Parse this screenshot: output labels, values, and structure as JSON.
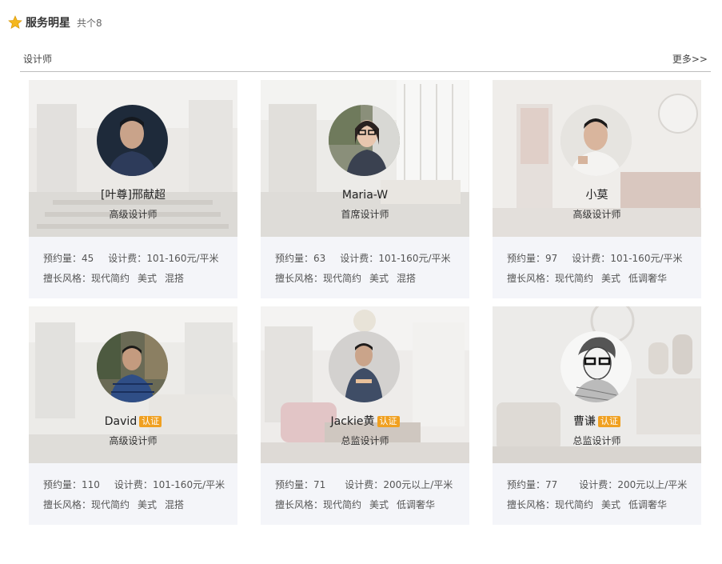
{
  "header": {
    "title": "服务明星",
    "count": "共个8"
  },
  "tab": {
    "label": "设计师",
    "more": "更多>>"
  },
  "labels": {
    "bookings": "预约量：",
    "fee": "设计费：",
    "styles": "擅长风格："
  },
  "colors": {
    "badge": "#f0a020",
    "card_bg": "#f4f5f9",
    "star": "#f5b71e"
  },
  "designers": [
    {
      "name": "[叶尊]邢献超",
      "verified": false,
      "badge": "",
      "role": "高级设计师",
      "bookings": "45",
      "fee": "101-160元/平米",
      "styles": [
        "现代简约",
        "美式",
        "混搭"
      ]
    },
    {
      "name": "Maria-W",
      "verified": false,
      "badge": "",
      "role": "首席设计师",
      "bookings": "63",
      "fee": "101-160元/平米",
      "styles": [
        "现代简约",
        "美式",
        "混搭"
      ]
    },
    {
      "name": "小莫",
      "verified": false,
      "badge": "",
      "role": "高级设计师",
      "bookings": "97",
      "fee": "101-160元/平米",
      "styles": [
        "现代简约",
        "美式",
        "低调奢华"
      ]
    },
    {
      "name": "David",
      "verified": true,
      "badge": "认证",
      "role": "高级设计师",
      "bookings": "110",
      "fee": "101-160元/平米",
      "styles": [
        "现代简约",
        "美式",
        "混搭"
      ]
    },
    {
      "name": "Jackie黄",
      "verified": true,
      "badge": "认证",
      "role": "总监设计师",
      "bookings": "71",
      "fee": "200元以上/平米",
      "styles": [
        "现代简约",
        "美式",
        "低调奢华"
      ]
    },
    {
      "name": "曹谦",
      "verified": true,
      "badge": "认证",
      "role": "总监设计师",
      "bookings": "77",
      "fee": "200元以上/平米",
      "styles": [
        "现代简约",
        "美式",
        "低调奢华"
      ]
    }
  ]
}
